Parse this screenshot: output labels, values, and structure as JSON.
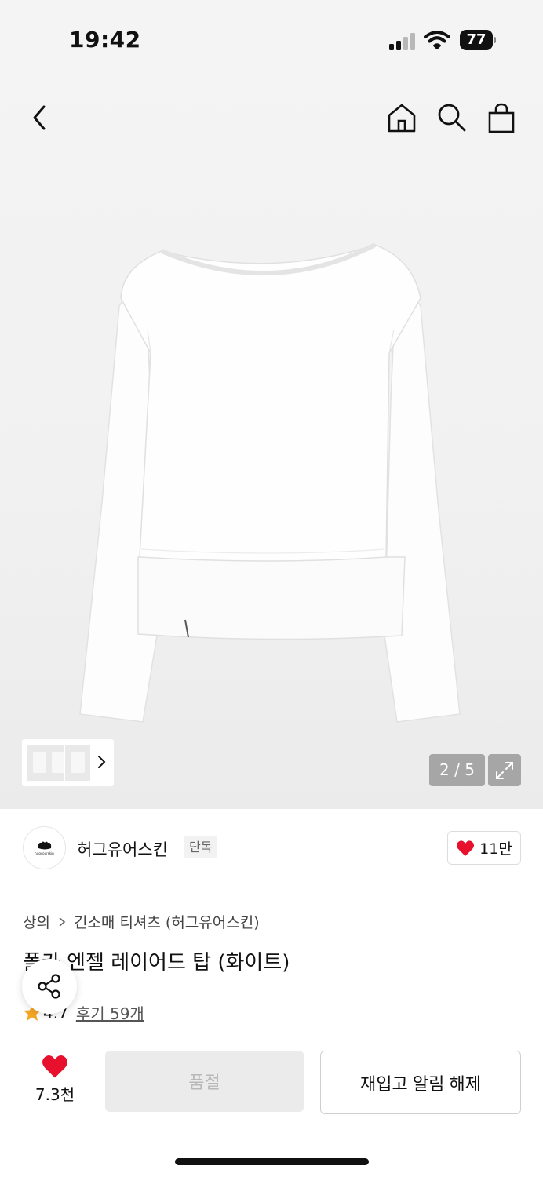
{
  "status_bar": {
    "time": "19:42",
    "battery": "77",
    "signal_bars": 4,
    "signal_bars_active": 2
  },
  "header": {
    "back_icon": "chevron-left-icon",
    "home_icon": "home-icon",
    "search_icon": "search-icon",
    "cart_icon": "shopping-bag-icon"
  },
  "gallery": {
    "page_counter": "2 / 5",
    "expand_icon": "expand-icon"
  },
  "brand": {
    "name": "허그유어스킨",
    "badge": "단독",
    "logo_wordmark": "hugyourskin",
    "likes": "11만"
  },
  "product": {
    "breadcrumb": [
      "상의",
      "긴소매 티셔츠 (허그유어스킨)"
    ],
    "title": "폴카 엔젤 레이어드 탑 (화이트)",
    "rating": "4.7",
    "reviews": "후기 59개"
  },
  "bottom_bar": {
    "wishlist_count": "7.3천",
    "soldout_label": "품절",
    "restock_label": "재입고 알림 해제"
  },
  "colors": {
    "heart": "#e8112d",
    "star": "#f5a623",
    "soldout_bg": "#ebebeb"
  }
}
